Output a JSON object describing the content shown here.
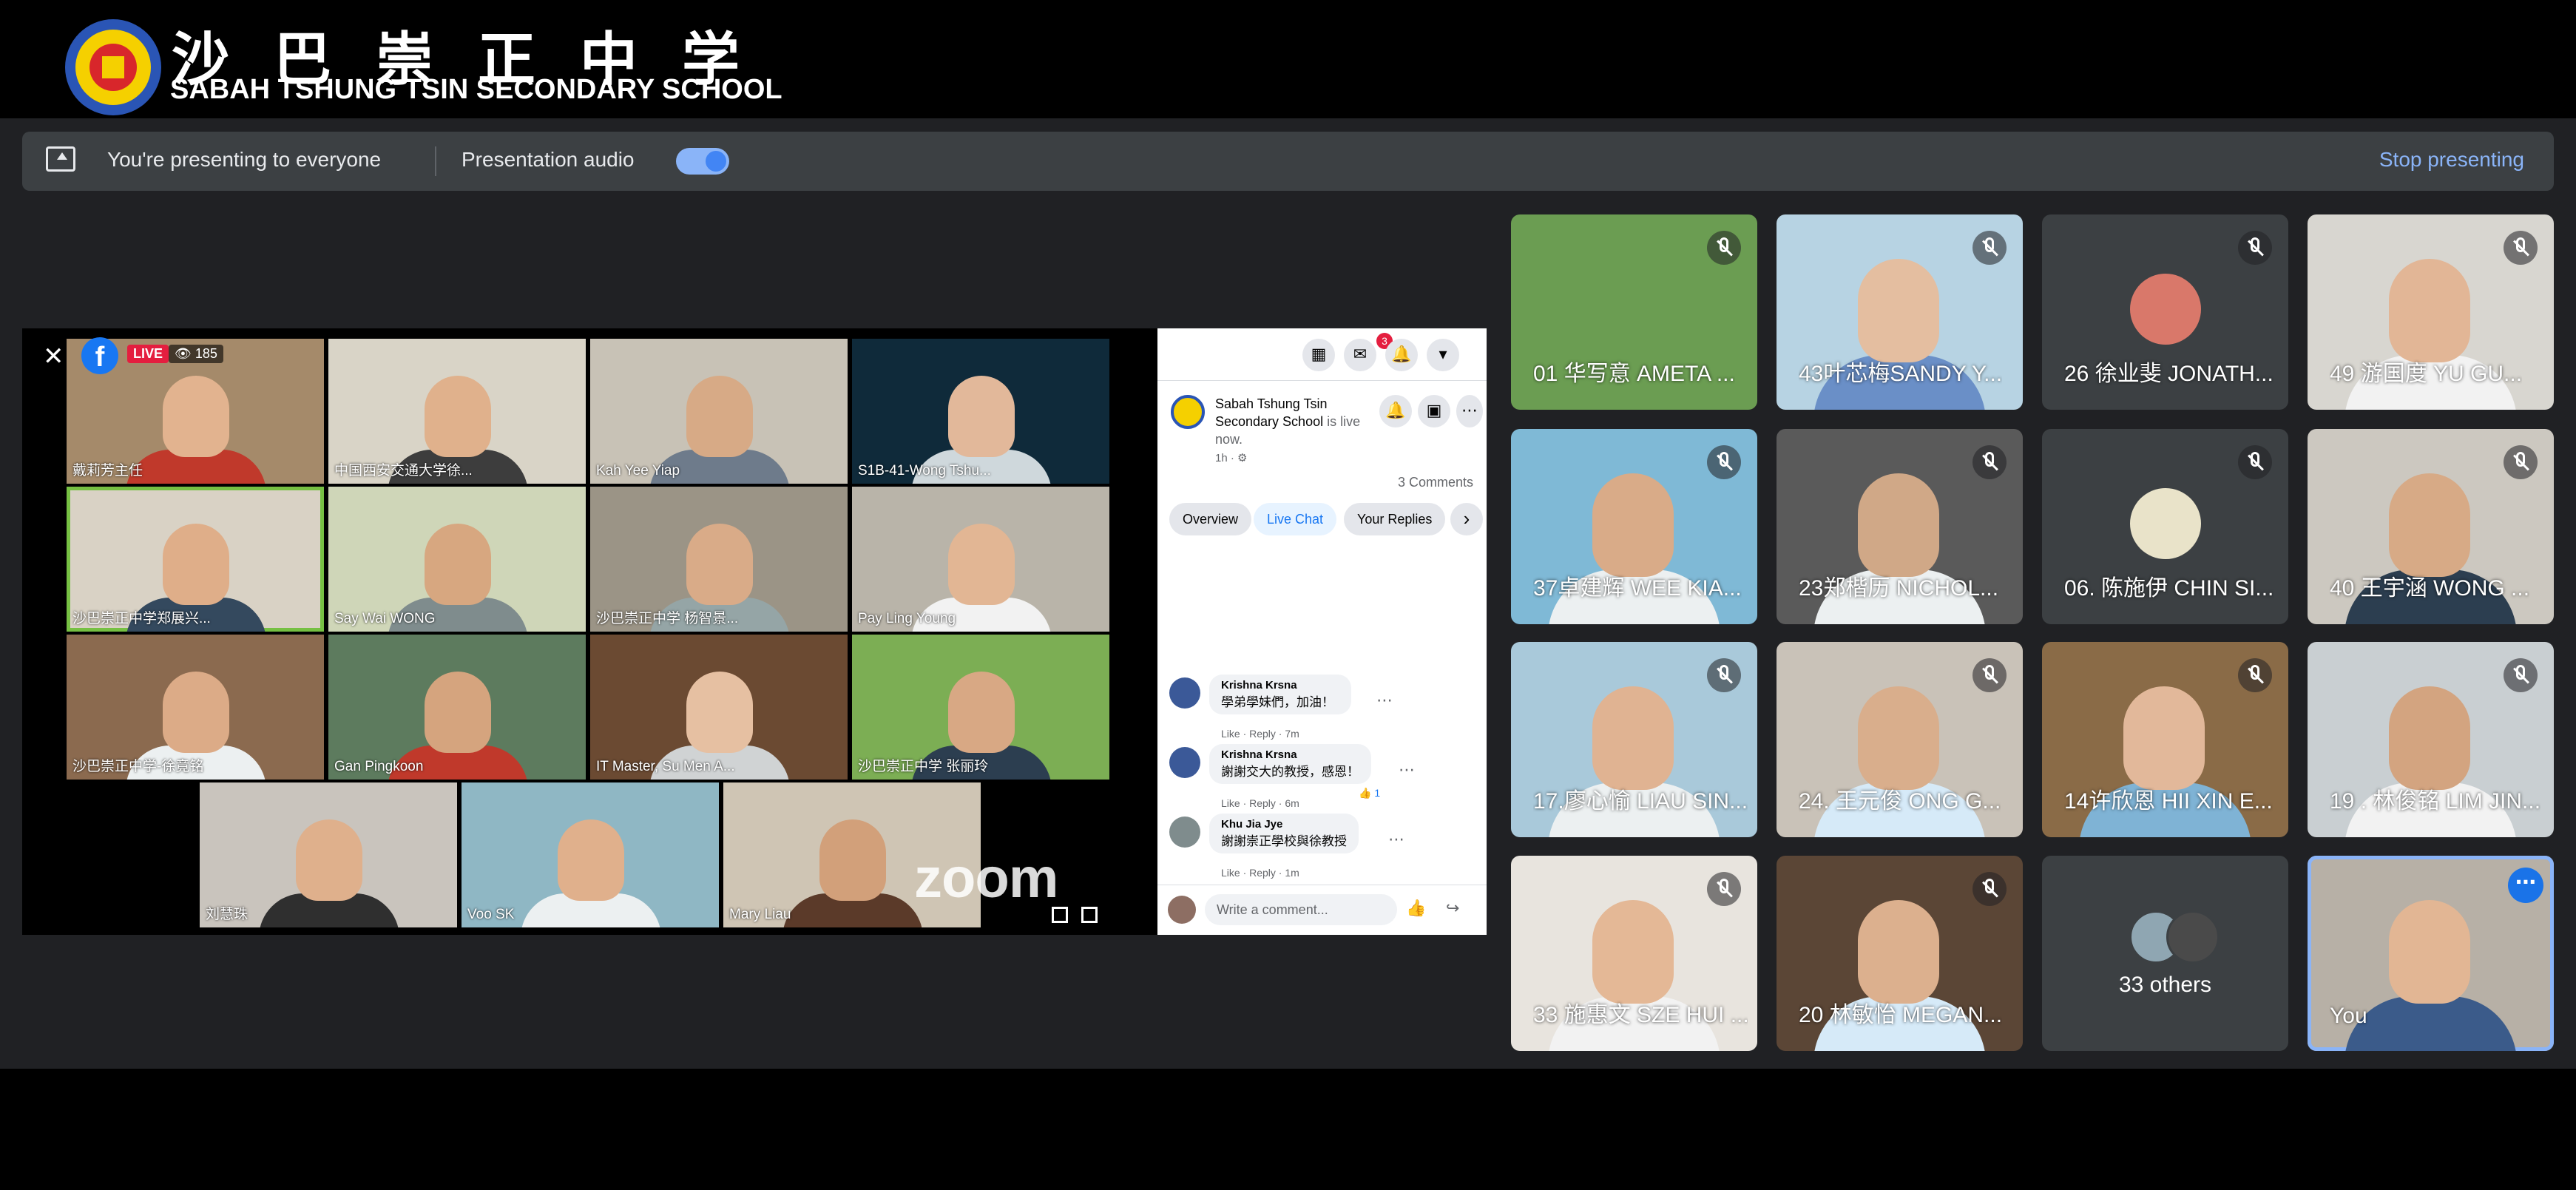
{
  "header": {
    "school_name_cn": "沙巴崇正中学",
    "school_name_en": "SABAH TSHUNG TSIN SECONDARY SCHOOL"
  },
  "presenting_bar": {
    "status_text": "You're presenting to everyone",
    "audio_label": "Presentation audio",
    "audio_enabled": true,
    "stop_label": "Stop presenting"
  },
  "shared_screen": {
    "live_label": "LIVE",
    "viewer_count": "185",
    "watermark": "zoom",
    "zoom_tiles": [
      {
        "name": "戴莉芳主任",
        "bg": "#a58a6a",
        "skin": "#e2b38f",
        "shirt": "#c0392b"
      },
      {
        "name": "中国西安交通大学徐...",
        "bg": "#d9d4c7",
        "skin": "#e0b18c",
        "shirt": "#3d3d3d"
      },
      {
        "name": "Kah Yee Yiap",
        "bg": "#c8c2b6",
        "skin": "#d7aa86",
        "shirt": "#6e7b8b"
      },
      {
        "name": "S1B-41-Wong Tshu...",
        "bg": "#0f2a3a",
        "skin": "#e2b89a",
        "shirt": "#cfd8dc"
      },
      {
        "name": "沙巴崇正中学郑展兴...",
        "bg": "#d9d2c5",
        "skin": "#dfae89",
        "shirt": "#34495e"
      },
      {
        "name": "Say Wai WONG",
        "bg": "#cfd6b8",
        "skin": "#d7a780",
        "shirt": "#7f8c8d"
      },
      {
        "name": "沙巴崇正中学 杨智景...",
        "bg": "#9b9486",
        "skin": "#d9ab88",
        "shirt": "#95a5a6"
      },
      {
        "name": "Pay Ling Young",
        "bg": "#b9b4a9",
        "skin": "#e2b694",
        "shirt": "#f2f2f2"
      },
      {
        "name": "沙巴崇正中学-徐竟铭",
        "bg": "#8b6a4f",
        "skin": "#dcab87",
        "shirt": "#ecf0f1"
      },
      {
        "name": "Gan Pingkoon",
        "bg": "#5d7b5e",
        "skin": "#d5a47e",
        "shirt": "#c0392b"
      },
      {
        "name": "IT Master, Su Men A...",
        "bg": "#6b4a32",
        "skin": "#e6c0a2",
        "shirt": "#d0d3d4"
      },
      {
        "name": "沙巴崇正中学 张丽玲",
        "bg": "#7cae54",
        "skin": "#d8a884",
        "shirt": "#2c3e50"
      },
      {
        "name": "刘慧珠",
        "bg": "#c9c4bd",
        "skin": "#dfb08c",
        "shirt": "#2f2f2f"
      },
      {
        "name": "Voo SK",
        "bg": "#8fb7c4",
        "skin": "#e0b08c",
        "shirt": "#ecf0f1"
      },
      {
        "name": "Mary Liau",
        "bg": "#cfc5b4",
        "skin": "#d2a07a",
        "shirt": "#5b3a29"
      }
    ],
    "facebook": {
      "page_name": "Sabah Tshung Tsin Secondary School",
      "status_text": "is live now.",
      "post_time": "1h · ⚙",
      "messenger_count": "3",
      "comments_count": "3 Comments",
      "tabs": [
        "Overview",
        "Live Chat",
        "Your Replies"
      ],
      "selected_tab": "Live Chat",
      "comments": [
        {
          "author": "Krishna Krsna",
          "message": "學弟學妹們，加油！",
          "meta": "Like · Reply · 7m",
          "likes": ""
        },
        {
          "author": "Krishna Krsna",
          "message": "謝謝交大的教授，感恩！",
          "meta": "Like · Reply · 6m",
          "likes": "1"
        },
        {
          "author": "Khu Jia Jye",
          "message": "謝謝崇正學校與徐教授",
          "meta": "Like · Reply · 1m",
          "likes": ""
        }
      ],
      "compose_placeholder": "Write a comment..."
    }
  },
  "participants": [
    {
      "name": "01 华写意 AMETA ...",
      "bg": "#6b9d52",
      "skin": "",
      "shirt": "",
      "muted": true
    },
    {
      "name": "43叶芯梅SANDY Y...",
      "bg": "#b7d3e3",
      "skin": "#e4bea0",
      "shirt": "#6a8fc7",
      "muted": true
    },
    {
      "name": "26 徐业斐 JONATH...",
      "bg": "#3c4043",
      "avatar": "#d9786a",
      "muted": true
    },
    {
      "name": "49 游国度 YU GU...",
      "bg": "#d8d6d0",
      "skin": "#e2b696",
      "shirt": "#f2f2f2",
      "muted": true
    },
    {
      "name": "37卓建辉 WEE KIA...",
      "bg": "#7fb9d6",
      "skin": "#d9ab88",
      "shirt": "#ecf0f1",
      "muted": true
    },
    {
      "name": "23郑楷历 NICHOL...",
      "bg": "#5a5a5a",
      "skin": "#d0a887",
      "shirt": "#ecf0f1",
      "muted": true
    },
    {
      "name": "06. 陈施伊 CHIN SI...",
      "bg": "#3c4043",
      "avatar": "#e9e3c9",
      "muted": true
    },
    {
      "name": "40 王宇涵 WONG ...",
      "bg": "#ccc8c0",
      "skin": "#d7aa86",
      "shirt": "#2c3e50",
      "muted": true
    },
    {
      "name": "17.廖心愉 LIAU SIN...",
      "bg": "#a9c9da",
      "skin": "#e0b392",
      "shirt": "#ecf0f1",
      "muted": true
    },
    {
      "name": "24. 王元俊 ONG G...",
      "bg": "#c9c2b8",
      "skin": "#d9ae8c",
      "shirt": "#d6eaf8",
      "muted": true
    },
    {
      "name": "14许欣恩 HII XIN E...",
      "bg": "#8a6b47",
      "skin": "#e2b89a",
      "shirt": "#7fb3d5",
      "muted": true
    },
    {
      "name": "19 . 林俊铭 LIM JIN...",
      "bg": "#c9cfd2",
      "skin": "#d3a480",
      "shirt": "#f2f2f2",
      "muted": true
    },
    {
      "name": "33 施惠文 SZE HUI ...",
      "bg": "#e8e4de",
      "skin": "#e4b896",
      "shirt": "#f2f2f2",
      "muted": true
    },
    {
      "name": "20 林敏怡 MEGAN...",
      "bg": "#5b4636",
      "skin": "#dcb08e",
      "shirt": "#d6eaf8",
      "muted": true
    },
    {
      "name": "33 others",
      "bg": "#3c4043",
      "others": true
    },
    {
      "name": "You",
      "bg": "#b7b0a6",
      "skin": "#e2b694",
      "shirt": "#3b5b8a",
      "you": true
    }
  ]
}
